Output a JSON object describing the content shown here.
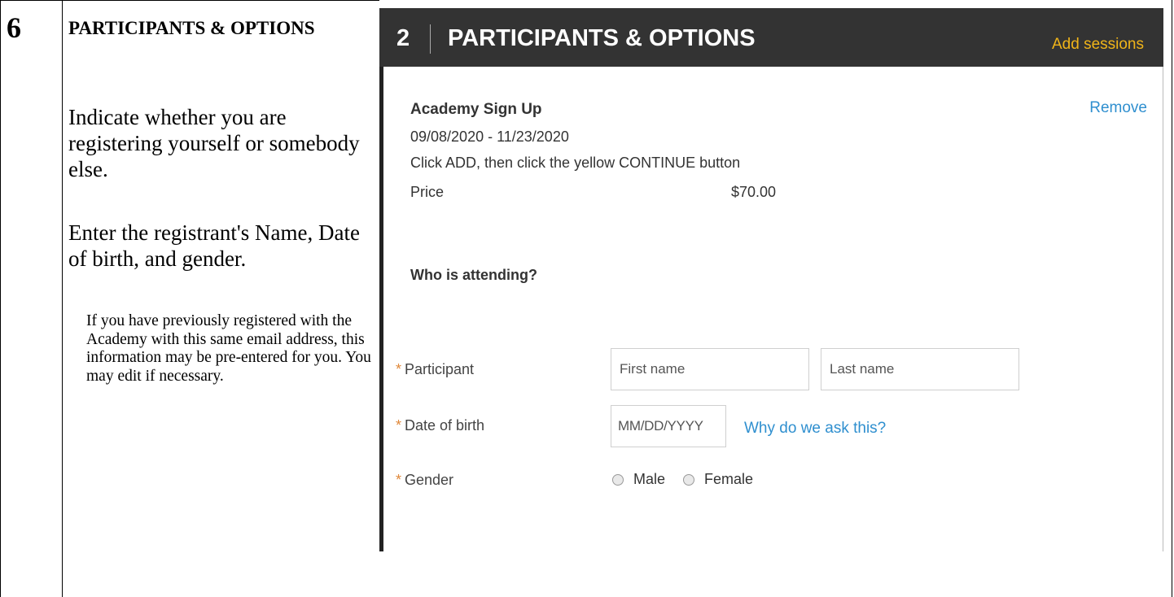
{
  "document": {
    "step_number": "6",
    "heading": "PARTICIPANTS & OPTIONS",
    "paragraph_1": "Indicate whether you are registering yourself or somebody else.",
    "paragraph_2": "Enter the registrant's Name, Date of birth, and gender.",
    "note": "If you have previously registered with the Academy with this same email address, this information may be pre-entered for you.  You may edit if necessary."
  },
  "screenshot": {
    "header": {
      "step_index": "2",
      "title": "PARTICIPANTS & OPTIONS",
      "add_sessions_label": "Add sessions"
    },
    "program": {
      "title": "Academy Sign Up",
      "remove_label": "Remove",
      "dates": "09/08/2020 - 11/23/2020",
      "instructions": "Click ADD, then click the yellow CONTINUE button",
      "price_label": "Price",
      "price_value": "$70.00"
    },
    "attending": {
      "heading": "Who is attending?",
      "required_marker": "*",
      "participant_label": "Participant",
      "first_name_placeholder": "First name",
      "first_name_value": "",
      "last_name_placeholder": "Last name",
      "last_name_value": "",
      "dob_label": "Date of birth",
      "dob_placeholder": "MM/DD/YYYY",
      "dob_value": "",
      "why_label": "Why do we ask this?",
      "gender_label": "Gender",
      "gender_options": [
        "Male",
        "Female"
      ]
    }
  },
  "colors": {
    "header_bg": "#333333",
    "accent_yellow": "#f0b419",
    "link_blue": "#2f8fcf",
    "required_orange": "#e0883a"
  }
}
